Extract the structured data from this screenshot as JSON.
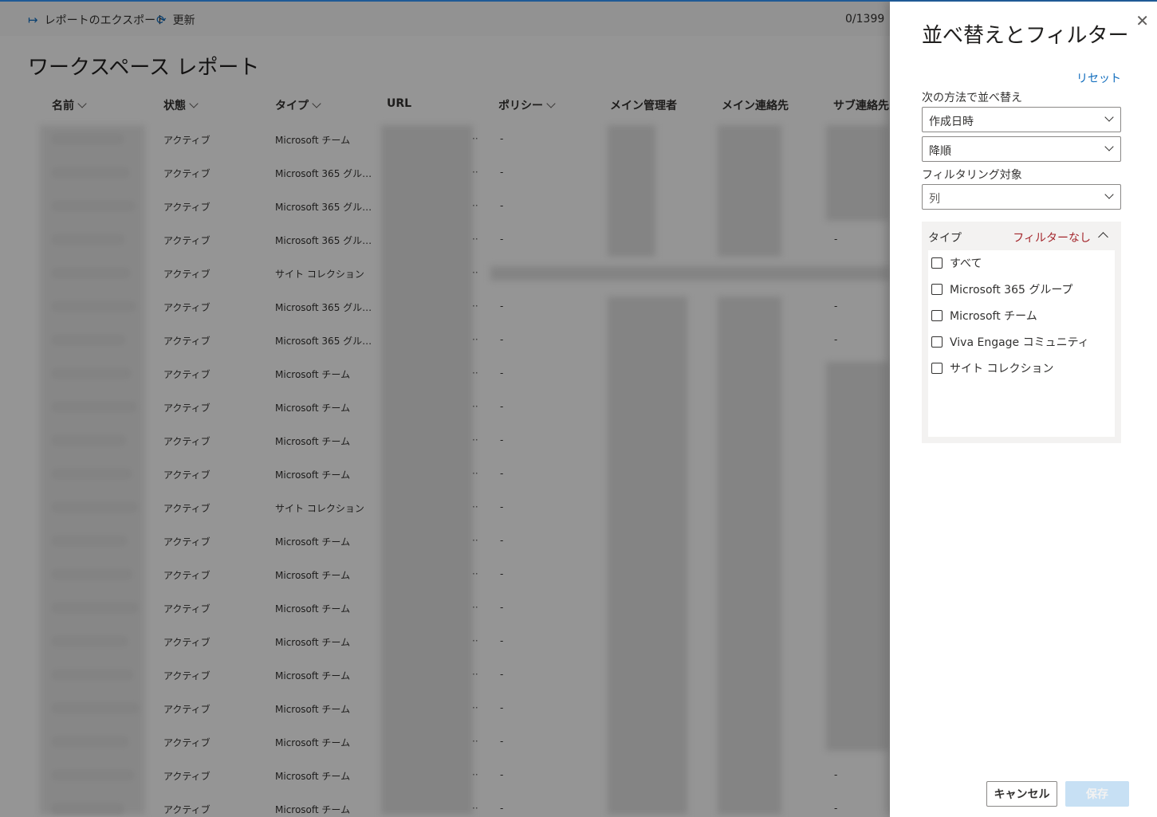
{
  "toolbar": {
    "export_label": "レポートのエクスポート",
    "refresh_label": "更新",
    "count": "0/1399"
  },
  "page": {
    "title": "ワークスペース レポート"
  },
  "table": {
    "headers": {
      "name": "名前",
      "status": "状態",
      "type": "タイプ",
      "url": "URL",
      "policy": "ポリシー",
      "main_admin": "メイン管理者",
      "main_contact": "メイン連絡先",
      "sub_contact": "サブ連絡先"
    },
    "rows": [
      {
        "status": "アクティブ",
        "type": "Microsoft チーム",
        "policy": "-",
        "sub": ""
      },
      {
        "status": "アクティブ",
        "type": "Microsoft 365 グル…",
        "policy": "-",
        "sub": ""
      },
      {
        "status": "アクティブ",
        "type": "Microsoft 365 グル…",
        "policy": "-",
        "sub": ""
      },
      {
        "status": "アクティブ",
        "type": "Microsoft 365 グル…",
        "policy": "-",
        "sub": "-"
      },
      {
        "status": "アクティブ",
        "type": "サイト コレクション",
        "policy": "",
        "sub": ""
      },
      {
        "status": "アクティブ",
        "type": "Microsoft 365 グル…",
        "policy": "-",
        "sub": "-"
      },
      {
        "status": "アクティブ",
        "type": "Microsoft 365 グル…",
        "policy": "-",
        "sub": "-"
      },
      {
        "status": "アクティブ",
        "type": "Microsoft チーム",
        "policy": "-",
        "sub": ""
      },
      {
        "status": "アクティブ",
        "type": "Microsoft チーム",
        "policy": "-",
        "sub": ""
      },
      {
        "status": "アクティブ",
        "type": "Microsoft チーム",
        "policy": "-",
        "sub": ""
      },
      {
        "status": "アクティブ",
        "type": "Microsoft チーム",
        "policy": "-",
        "sub": ""
      },
      {
        "status": "アクティブ",
        "type": "サイト コレクション",
        "policy": "-",
        "sub": ""
      },
      {
        "status": "アクティブ",
        "type": "Microsoft チーム",
        "policy": "-",
        "sub": ""
      },
      {
        "status": "アクティブ",
        "type": "Microsoft チーム",
        "policy": "-",
        "sub": ""
      },
      {
        "status": "アクティブ",
        "type": "Microsoft チーム",
        "policy": "-",
        "sub": ""
      },
      {
        "status": "アクティブ",
        "type": "Microsoft チーム",
        "policy": "-",
        "sub": ""
      },
      {
        "status": "アクティブ",
        "type": "Microsoft チーム",
        "policy": "-",
        "sub": ""
      },
      {
        "status": "アクティブ",
        "type": "Microsoft チーム",
        "policy": "-",
        "sub": ""
      },
      {
        "status": "アクティブ",
        "type": "Microsoft チーム",
        "policy": "-",
        "sub": ""
      },
      {
        "status": "アクティブ",
        "type": "Microsoft チーム",
        "policy": "-",
        "sub": "-"
      },
      {
        "status": "アクティブ",
        "type": "Microsoft チーム",
        "policy": "-",
        "sub": "-"
      }
    ]
  },
  "panel": {
    "title": "並べ替えとフィルター",
    "close_icon": "close-icon",
    "reset_label": "リセット",
    "sort_label": "次の方法で並べ替え",
    "sort_field": "作成日時",
    "sort_order": "降順",
    "filter_label": "フィルタリング対象",
    "filter_placeholder": "列",
    "filter_group": {
      "title": "タイプ",
      "status": "フィルターなし",
      "options": [
        "すべて",
        "Microsoft 365 グループ",
        "Microsoft チーム",
        "Viva Engage コミュニティ",
        "サイト コレクション"
      ]
    },
    "cancel_label": "キャンセル",
    "save_label": "保存"
  },
  "colors": {
    "accent": "#0f6cbd",
    "filter_status": "#a4262c",
    "save_disabled": "#c7e0f4"
  }
}
